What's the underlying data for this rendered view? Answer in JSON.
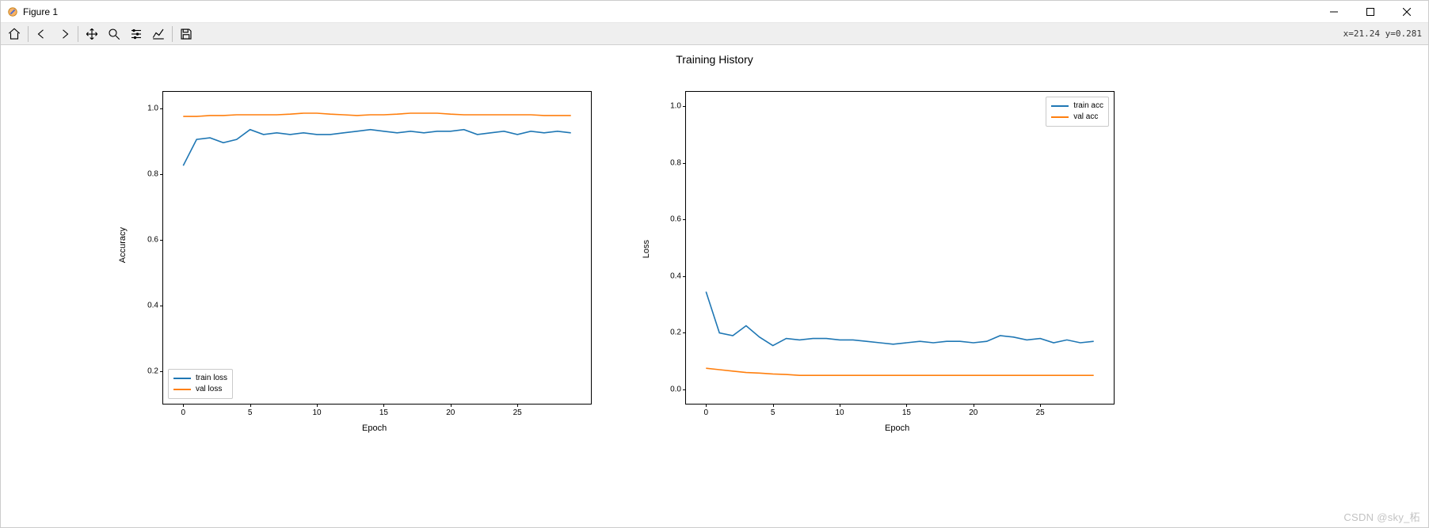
{
  "window": {
    "title": "Figure 1"
  },
  "toolbar": {
    "icons": [
      "home",
      "back",
      "forward",
      "pan",
      "zoom",
      "subplots",
      "axis",
      "save"
    ],
    "cursor_readout": "x=21.24 y=0.281"
  },
  "suptitle": "Training History",
  "watermark": "CSDN @sky_柘",
  "colors": {
    "series0": "#1f77b4",
    "series1": "#ff7f0e"
  },
  "left_plot": {
    "ylabel": "Accuracy",
    "xlabel": "Epoch",
    "legend_pos": "lower-left",
    "legend": [
      "train loss",
      "val loss"
    ],
    "yticks": [
      "0.2",
      "0.4",
      "0.6",
      "0.8",
      "1.0"
    ],
    "xticks": [
      "0",
      "5",
      "10",
      "15",
      "20",
      "25"
    ]
  },
  "right_plot": {
    "ylabel": "Loss",
    "xlabel": "Epoch",
    "legend_pos": "upper-right",
    "legend": [
      "train acc",
      "val acc"
    ],
    "yticks": [
      "0.0",
      "0.2",
      "0.4",
      "0.6",
      "0.8",
      "1.0"
    ],
    "xticks": [
      "0",
      "5",
      "10",
      "15",
      "20",
      "25"
    ]
  },
  "chart_data": [
    {
      "type": "line",
      "title": "",
      "xlabel": "Epoch",
      "ylabel": "Accuracy",
      "xlim": [
        -1.5,
        30.5
      ],
      "ylim": [
        0.1,
        1.05
      ],
      "x": [
        0,
        1,
        2,
        3,
        4,
        5,
        6,
        7,
        8,
        9,
        10,
        11,
        12,
        13,
        14,
        15,
        16,
        17,
        18,
        19,
        20,
        21,
        22,
        23,
        24,
        25,
        26,
        27,
        28,
        29
      ],
      "series": [
        {
          "name": "train loss",
          "color": "#1f77b4",
          "values": [
            0.825,
            0.905,
            0.91,
            0.895,
            0.905,
            0.935,
            0.92,
            0.925,
            0.92,
            0.925,
            0.92,
            0.92,
            0.925,
            0.93,
            0.935,
            0.93,
            0.925,
            0.93,
            0.925,
            0.93,
            0.93,
            0.935,
            0.92,
            0.925,
            0.93,
            0.92,
            0.93,
            0.925,
            0.93,
            0.925
          ]
        },
        {
          "name": "val loss",
          "color": "#ff7f0e",
          "values": [
            0.975,
            0.975,
            0.978,
            0.978,
            0.98,
            0.98,
            0.98,
            0.98,
            0.982,
            0.985,
            0.985,
            0.982,
            0.98,
            0.978,
            0.98,
            0.98,
            0.982,
            0.985,
            0.985,
            0.985,
            0.982,
            0.98,
            0.98,
            0.98,
            0.98,
            0.98,
            0.98,
            0.978,
            0.978,
            0.978
          ]
        }
      ],
      "legend": [
        "train loss",
        "val loss"
      ],
      "legend_pos": "lower left"
    },
    {
      "type": "line",
      "title": "",
      "xlabel": "Epoch",
      "ylabel": "Loss",
      "xlim": [
        -1.5,
        30.5
      ],
      "ylim": [
        -0.05,
        1.05
      ],
      "x": [
        0,
        1,
        2,
        3,
        4,
        5,
        6,
        7,
        8,
        9,
        10,
        11,
        12,
        13,
        14,
        15,
        16,
        17,
        18,
        19,
        20,
        21,
        22,
        23,
        24,
        25,
        26,
        27,
        28,
        29
      ],
      "series": [
        {
          "name": "train acc",
          "color": "#1f77b4",
          "values": [
            0.345,
            0.2,
            0.19,
            0.225,
            0.185,
            0.155,
            0.18,
            0.175,
            0.18,
            0.18,
            0.175,
            0.175,
            0.17,
            0.165,
            0.16,
            0.165,
            0.17,
            0.165,
            0.17,
            0.17,
            0.165,
            0.17,
            0.19,
            0.185,
            0.175,
            0.18,
            0.165,
            0.175,
            0.165,
            0.17
          ]
        },
        {
          "name": "val acc",
          "color": "#ff7f0e",
          "values": [
            0.075,
            0.07,
            0.065,
            0.06,
            0.058,
            0.055,
            0.053,
            0.05,
            0.05,
            0.05,
            0.05,
            0.05,
            0.05,
            0.05,
            0.05,
            0.05,
            0.05,
            0.05,
            0.05,
            0.05,
            0.05,
            0.05,
            0.05,
            0.05,
            0.05,
            0.05,
            0.05,
            0.05,
            0.05,
            0.05
          ]
        }
      ],
      "legend": [
        "train acc",
        "val acc"
      ],
      "legend_pos": "upper right"
    }
  ]
}
